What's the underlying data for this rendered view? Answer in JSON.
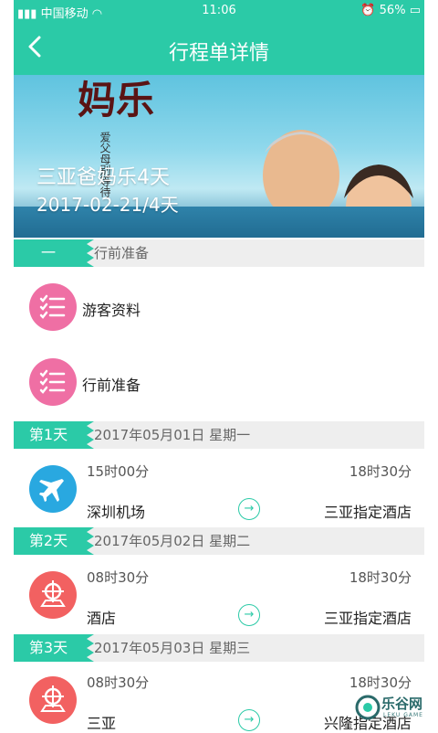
{
  "status_bar": {
    "carrier": "中国移动",
    "time": "11:06",
    "battery": "56%"
  },
  "nav": {
    "title": "行程单详情"
  },
  "banner": {
    "title": "三亚爸妈乐4天",
    "subtitle": "2017-02-21/4天",
    "poster_text": "妈乐",
    "poster_small": "爱父母别等待"
  },
  "prep_section": {
    "tag": "一",
    "title": "行前准备",
    "items": [
      {
        "label": "游客资料"
      },
      {
        "label": "行前准备"
      }
    ]
  },
  "days": [
    {
      "tag": "第1天",
      "date": "2017年05月01日  星期一",
      "route": {
        "start_time": "15时00分",
        "end_time": "18时30分",
        "from": "深圳机场",
        "to": "三亚指定酒店"
      }
    },
    {
      "tag": "第2天",
      "date": "2017年05月02日  星期二",
      "route": {
        "start_time": "08时30分",
        "end_time": "18时30分",
        "from": "酒店",
        "to": "三亚指定酒店"
      }
    },
    {
      "tag": "第3天",
      "date": "2017年05月03日  星期三",
      "route": {
        "start_time": "08时30分",
        "end_time": "18时30分",
        "from": "三亚",
        "to": "兴隆指定酒店"
      }
    }
  ],
  "watermark": {
    "text": "乐谷网",
    "sub": "LEKU GAME"
  },
  "colors": {
    "accent": "#2bcaa7",
    "pink": "#ef6fa4",
    "blue": "#29a8e0",
    "red": "#f26161"
  }
}
